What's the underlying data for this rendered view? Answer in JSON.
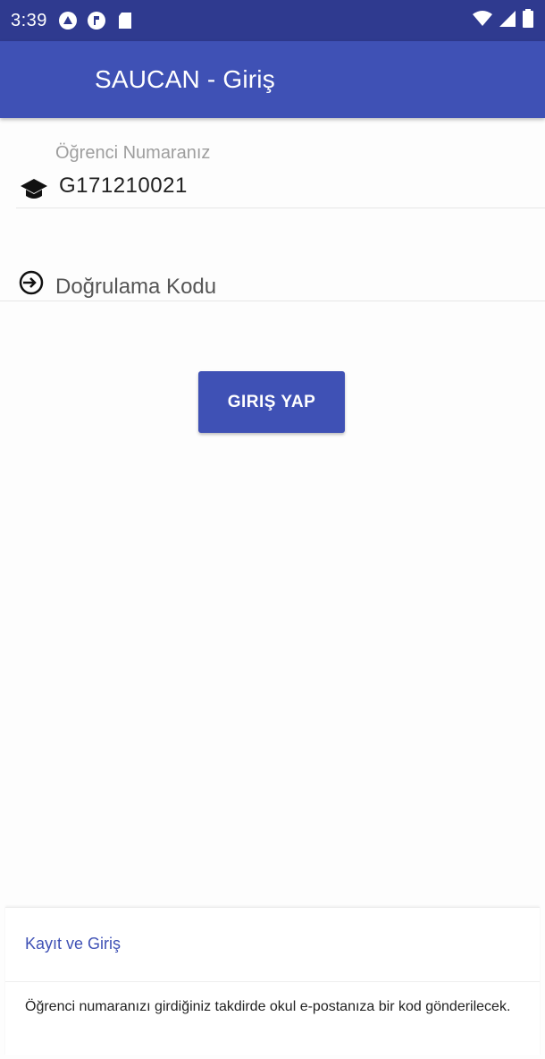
{
  "status_bar": {
    "time": "3:39",
    "left_icons": [
      "vpn-icon",
      "sync-icon",
      "sd-card-icon"
    ],
    "right_icons": [
      "wifi-icon",
      "signal-icon",
      "battery-icon"
    ],
    "color": "#2f3a8f"
  },
  "app_bar": {
    "title": "SAUCAN - Giriş",
    "color": "#3f51b5"
  },
  "student_field": {
    "label": "Öğrenci Numaranız",
    "value": "G171210021",
    "icon": "graduation-cap-icon"
  },
  "code_field": {
    "placeholder": "Doğrulama Kodu",
    "icon": "login-icon"
  },
  "login_button": {
    "label": "GIRIŞ YAP",
    "color": "#3f51b5"
  },
  "bottom_card": {
    "link": "Kayıt ve Giriş",
    "info": "Öğrenci numaranızı girdiğiniz takdirde okul e-postanıza bir kod gönderilecek."
  }
}
